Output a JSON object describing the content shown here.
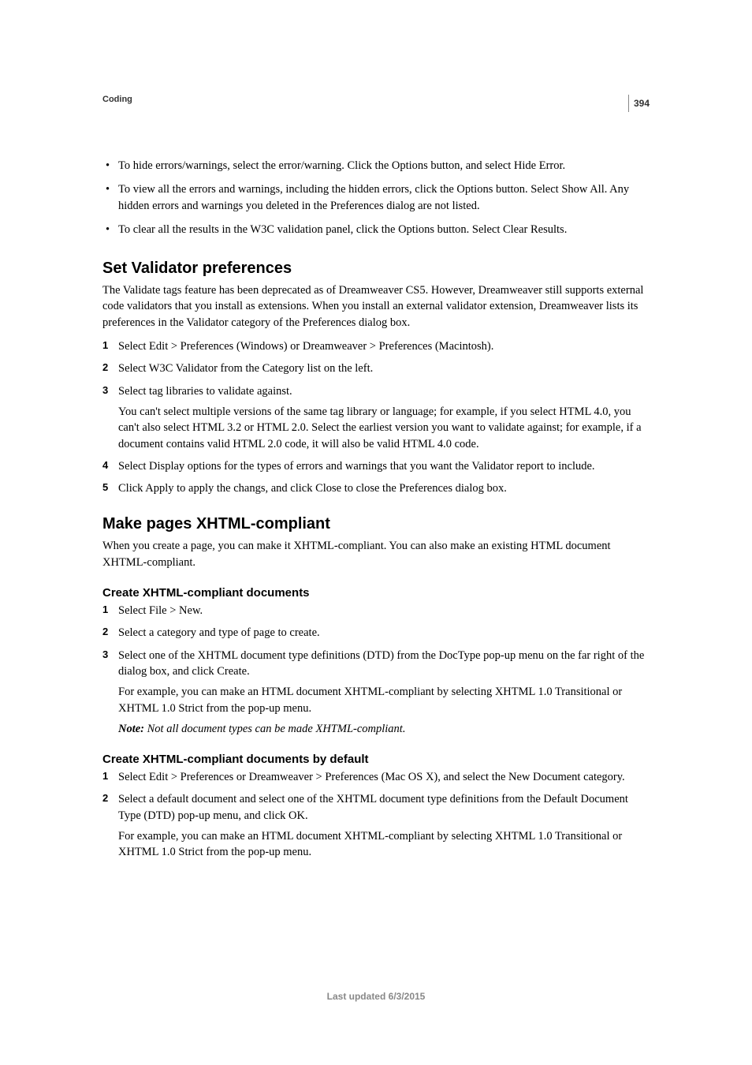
{
  "header": {
    "section": "Coding",
    "page_number": "394"
  },
  "top_bullets": [
    "To hide errors/warnings, select the error/warning. Click the Options button, and select Hide Error.",
    "To view all the errors and warnings, including the hidden errors, click the Options button. Select Show All. Any hidden errors and warnings you deleted in the Preferences dialog are not listed.",
    "To clear all the results in the W3C validation panel, click the Options button. Select Clear Results."
  ],
  "validator": {
    "heading": "Set Validator preferences",
    "intro": "The Validate tags feature has been deprecated as of Dreamweaver CS5. However, Dreamweaver still supports external code validators that you install as extensions. When you install an external validator extension, Dreamweaver lists its preferences in the Validator category of the Preferences dialog box.",
    "steps": {
      "s1": "Select Edit > Preferences (Windows) or Dreamweaver > Preferences (Macintosh).",
      "s2": "Select W3C Validator from the Category list on the left.",
      "s3": "Select tag libraries to validate against.",
      "s3b": "You can't select multiple versions of the same tag library or language; for example, if you select HTML 4.0, you can't also select HTML 3.2 or HTML 2.0. Select the earliest version you want to validate against; for example, if a document contains valid HTML 2.0 code, it will also be valid HTML 4.0 code.",
      "s4": "Select Display options for the types of errors and warnings that you want the Validator report to include.",
      "s5": "Click Apply to apply the changs, and click Close to close the Preferences dialog box."
    }
  },
  "xhtml": {
    "heading": "Make pages XHTML-compliant",
    "intro": "When you create a page, you can make it XHTML-compliant. You can also make an existing HTML document XHTML-compliant.",
    "create": {
      "heading": "Create XHTML-compliant documents",
      "s1": "Select File > New.",
      "s2": "Select a category and type of page to create.",
      "s3": "Select one of the XHTML document type definitions (DTD) from the DocType pop-up menu on the far right of the dialog box, and click Create.",
      "s3b": "For example, you can make an HTML document XHTML-compliant by selecting XHTML 1.0 Transitional or XHTML 1.0 Strict from the pop-up menu.",
      "note_label": "Note:",
      "note_text": " Not all document types can be made XHTML-compliant."
    },
    "default": {
      "heading": "Create XHTML-compliant documents by default",
      "s1": "Select Edit > Preferences or Dreamweaver > Preferences (Mac OS X), and select the New Document category.",
      "s2": "Select a default document and select one of the XHTML document type definitions from the Default Document Type (DTD) pop-up menu, and click OK.",
      "s2b": "For example, you can make an HTML document XHTML-compliant by selecting XHTML 1.0 Transitional or XHTML 1.0 Strict from the pop-up menu."
    }
  },
  "footer": "Last updated 6/3/2015"
}
